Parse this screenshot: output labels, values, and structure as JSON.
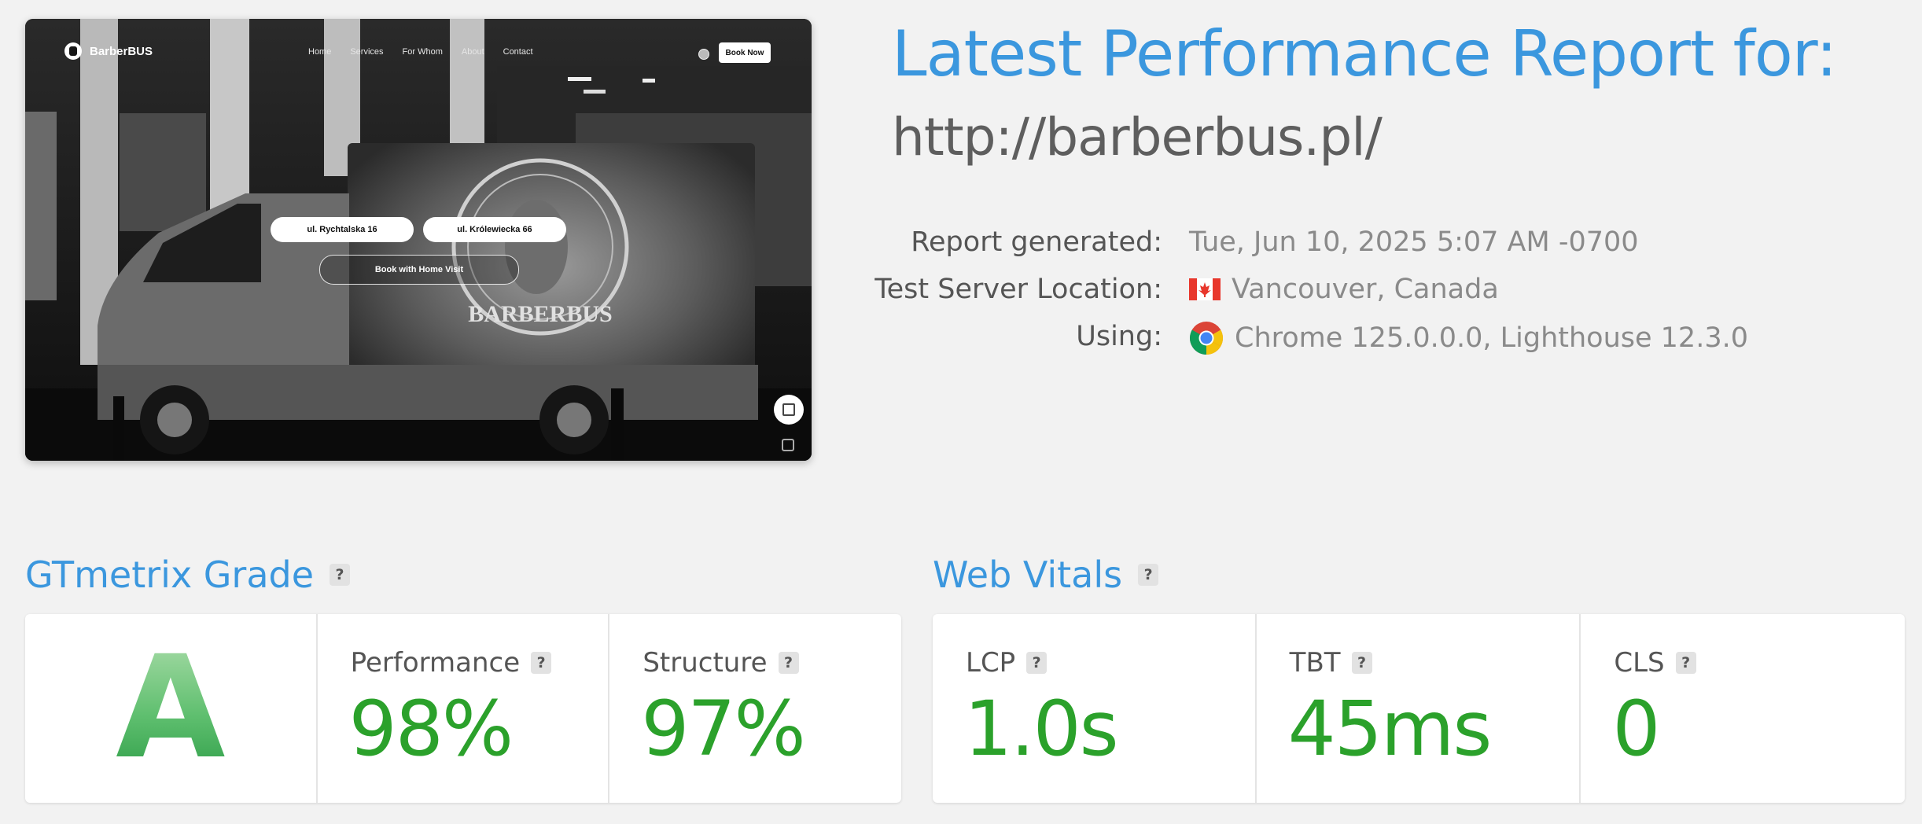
{
  "report": {
    "title": "Latest Performance Report for:",
    "url": "http://barberbus.pl/",
    "meta": [
      {
        "label": "Report generated:",
        "value": "Tue, Jun 10, 2025 5:07 AM -0700"
      },
      {
        "label": "Test Server Location:",
        "value": "Vancouver, Canada",
        "icon": "canada-flag-icon"
      },
      {
        "label": "Using:",
        "value": "Chrome 125.0.0.0, Lighthouse 12.3.0",
        "icon": "chrome-icon"
      }
    ]
  },
  "screenshot": {
    "brand": "BarberBUS",
    "nav": [
      "Home",
      "Services",
      "For Whom",
      "About",
      "Contact"
    ],
    "cta": "Book Now",
    "locations": [
      "ul. Rychtalska 16",
      "ul. Królewiecka 66"
    ],
    "home_visit": "Book with Home Visit",
    "van_text": "BARBERBUS"
  },
  "grade_section": {
    "title": "GTmetrix Grade",
    "help": "?",
    "grade": "A",
    "metrics": [
      {
        "label": "Performance",
        "value": "98%"
      },
      {
        "label": "Structure",
        "value": "97%"
      }
    ]
  },
  "vitals_section": {
    "title": "Web Vitals",
    "help": "?",
    "metrics": [
      {
        "label": "LCP",
        "value": "1.0s"
      },
      {
        "label": "TBT",
        "value": "45ms"
      },
      {
        "label": "CLS",
        "value": "0"
      }
    ]
  },
  "colors": {
    "accent": "#3b97de",
    "good": "#2ba12b",
    "grade_a": "#5fbf6f",
    "text_muted": "#8a8a8a"
  }
}
